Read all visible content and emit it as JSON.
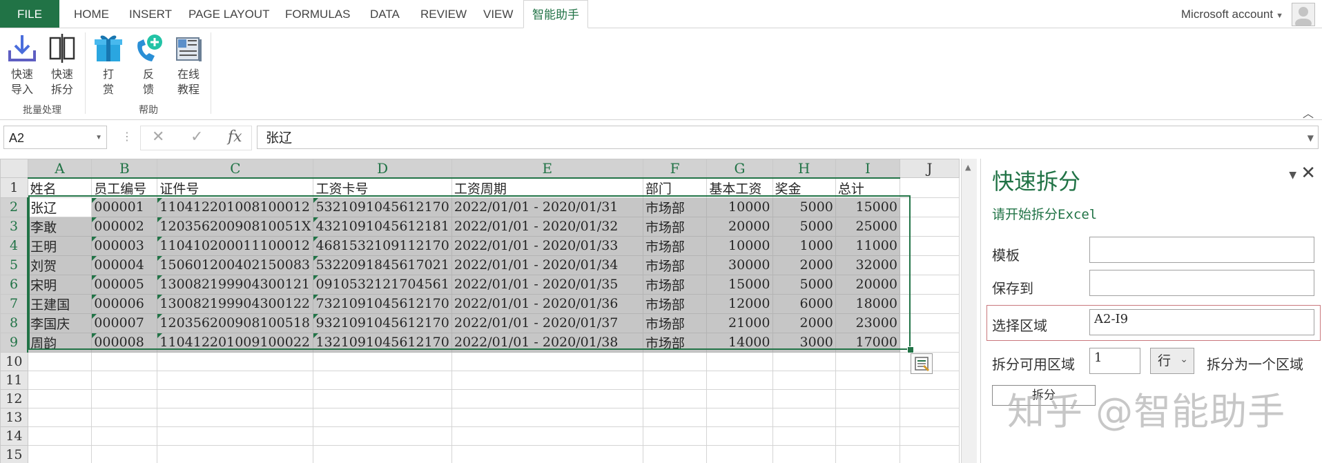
{
  "tabs": {
    "file": "FILE",
    "items": [
      "HOME",
      "INSERT",
      "PAGE LAYOUT",
      "FORMULAS",
      "DATA",
      "REVIEW",
      "VIEW"
    ],
    "active": "智能助手"
  },
  "account": {
    "label": "Microsoft account"
  },
  "ribbon": {
    "batch_group": {
      "label": "批量处理",
      "import": [
        "快速",
        "导入"
      ],
      "split": [
        "快速",
        "拆分"
      ]
    },
    "help_group": {
      "label": "帮助",
      "reward": [
        "打",
        "赏"
      ],
      "feedback": [
        "反",
        "馈"
      ],
      "tutorial": [
        "在线",
        "教程"
      ]
    }
  },
  "formula_bar": {
    "name_box": "A2",
    "fx": "fx",
    "cancel": "✕",
    "enter": "✓",
    "value": "张辽"
  },
  "sheet": {
    "columns": [
      "A",
      "B",
      "C",
      "D",
      "E",
      "F",
      "G",
      "H",
      "I",
      "J"
    ],
    "row_numbers": [
      "1",
      "2",
      "3",
      "4",
      "5",
      "6",
      "7",
      "8",
      "9",
      "10",
      "11",
      "12",
      "13",
      "14",
      "15"
    ],
    "header": [
      "姓名",
      "员工编号",
      "证件号",
      "工资卡号",
      "工资周期",
      "部门",
      "基本工资",
      "奖金",
      "总计"
    ],
    "rows": [
      [
        "张辽",
        "000001",
        "110412201008100012",
        "5321091045612170",
        "2022/01/01 - 2020/01/31",
        "市场部",
        "10000",
        "5000",
        "15000"
      ],
      [
        "李敢",
        "000002",
        "12035620090810051X",
        "4321091045612181",
        "2022/01/01 - 2020/01/32",
        "市场部",
        "20000",
        "5000",
        "25000"
      ],
      [
        "王明",
        "000003",
        "110410200011100012",
        "4681532109112170",
        "2022/01/01 - 2020/01/33",
        "市场部",
        "10000",
        "1000",
        "11000"
      ],
      [
        "刘贺",
        "000004",
        "150601200402150083",
        "5322091845617021",
        "2022/01/01 - 2020/01/34",
        "市场部",
        "30000",
        "2000",
        "32000"
      ],
      [
        "宋明",
        "000005",
        "130082199904300121",
        "0910532121704561",
        "2022/01/01 - 2020/01/35",
        "市场部",
        "15000",
        "5000",
        "20000"
      ],
      [
        "王建国",
        "000006",
        "130082199904300122",
        "7321091045612170",
        "2022/01/01 - 2020/01/36",
        "市场部",
        "12000",
        "6000",
        "18000"
      ],
      [
        "李国庆",
        "000007",
        "120356200908100518",
        "9321091045612170",
        "2022/01/01 - 2020/01/37",
        "市场部",
        "21000",
        "2000",
        "23000"
      ],
      [
        "周韵",
        "000008",
        "110412201009100022",
        "1321091045612170",
        "2022/01/01 - 2020/01/38",
        "市场部",
        "14000",
        "3000",
        "17000"
      ]
    ]
  },
  "pane": {
    "title": "快速拆分",
    "subtitle": "请开始拆分Excel",
    "template_label": "模板",
    "template_value": "",
    "save_label": "保存到",
    "save_value": "",
    "region_label": "选择区域",
    "region_value": "A2-I9",
    "split_label": "拆分可用区域",
    "split_count": "1",
    "split_unit": "行",
    "split_suffix": "拆分为一个区域",
    "split_button": "拆分",
    "watermark": "知乎 @智能助手"
  }
}
